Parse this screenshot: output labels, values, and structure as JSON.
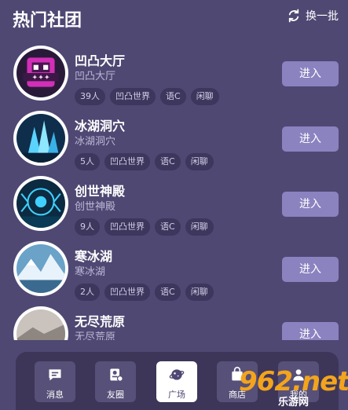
{
  "header": {
    "title": "热门社团",
    "refresh_label": "换一批"
  },
  "groups": [
    {
      "name": "凹凸大厅",
      "subtitle": "凹凸大厅",
      "tags": [
        "39人",
        "凹凸世界",
        "语C",
        "闲聊"
      ],
      "button": "进入"
    },
    {
      "name": "冰湖洞穴",
      "subtitle": "冰湖洞穴",
      "tags": [
        "5人",
        "凹凸世界",
        "语C",
        "闲聊"
      ],
      "button": "进入"
    },
    {
      "name": "创世神殿",
      "subtitle": "创世神殿",
      "tags": [
        "9人",
        "凹凸世界",
        "语C",
        "闲聊"
      ],
      "button": "进入"
    },
    {
      "name": "寒冰湖",
      "subtitle": "寒冰湖",
      "tags": [
        "2人",
        "凹凸世界",
        "语C",
        "闲聊"
      ],
      "button": "进入"
    },
    {
      "name": "无尽荒原",
      "subtitle": "无尽荒原",
      "tags": [],
      "button": "进入"
    }
  ],
  "tabs": [
    {
      "label": "消息",
      "icon": "message-icon"
    },
    {
      "label": "友圈",
      "icon": "friends-circle-icon"
    },
    {
      "label": "广场",
      "icon": "planet-icon",
      "active": true
    },
    {
      "label": "商店",
      "icon": "shop-icon"
    },
    {
      "label": "我的",
      "icon": "profile-icon"
    }
  ],
  "watermark": {
    "main": "962.net",
    "sub": "乐游网"
  },
  "colors": {
    "background": "#4f4873",
    "button": "#8b82c0",
    "tag": "#3d365d",
    "tabbar": "#3d3659",
    "watermark": "#f3a41d"
  }
}
